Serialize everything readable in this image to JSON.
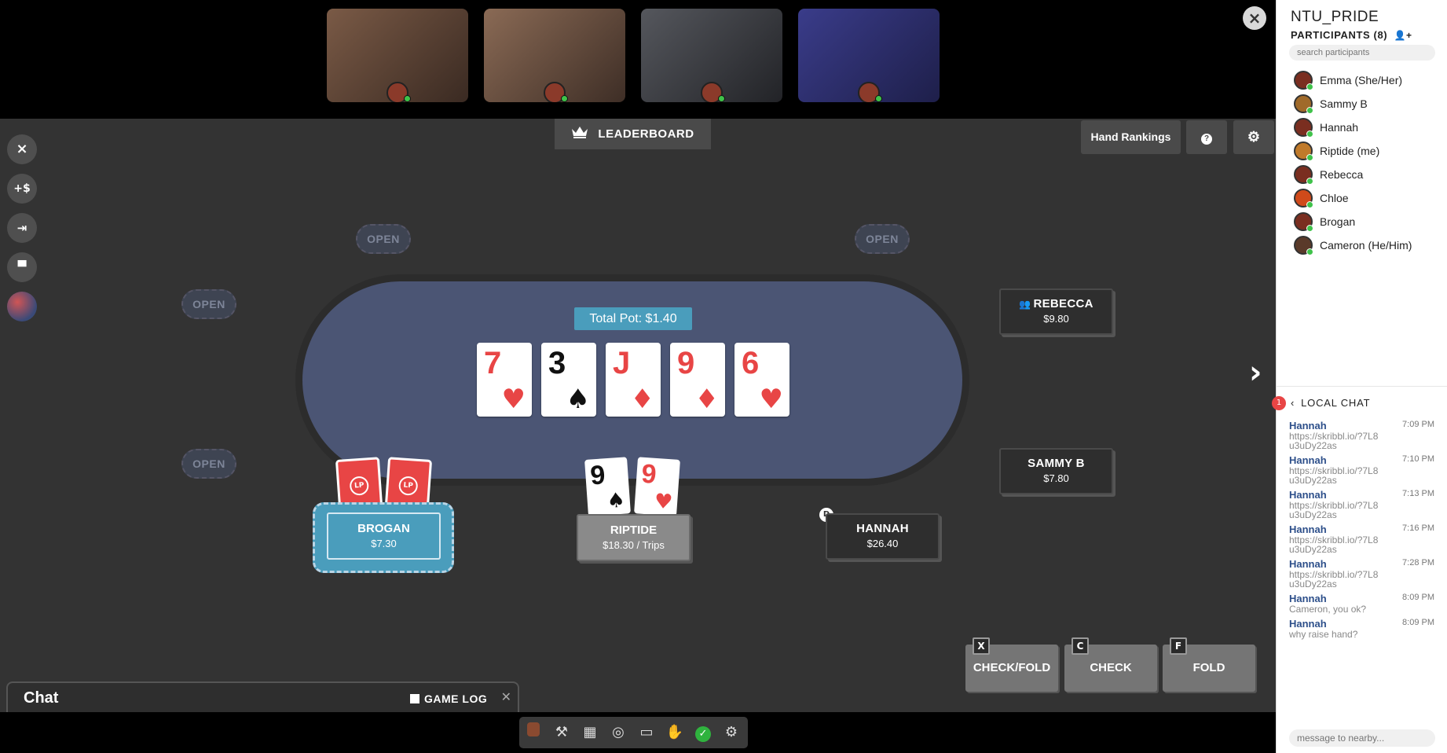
{
  "video": {
    "tiles": [
      {
        "bg": "#6b4a3a"
      },
      {
        "bg": "#5a4437"
      },
      {
        "bg": "#3d3f44"
      },
      {
        "bg": "#3b3c80"
      }
    ]
  },
  "game": {
    "leaderboard_label": "LEADERBOARD",
    "hand_rankings_label": "Hand Rankings",
    "help_icon": "?",
    "open_label": "OPEN",
    "pot_label": "Total Pot: $1.40",
    "board": [
      {
        "rank": "7",
        "suit": "♥",
        "color": "red"
      },
      {
        "rank": "3",
        "suit": "♠",
        "color": "black"
      },
      {
        "rank": "J",
        "suit": "♦",
        "color": "red"
      },
      {
        "rank": "9",
        "suit": "♦",
        "color": "red"
      },
      {
        "rank": "6",
        "suit": "♥",
        "color": "red"
      }
    ],
    "seats": {
      "rebecca": {
        "name": "REBECCA",
        "amount": "$9.80"
      },
      "sammy": {
        "name": "SAMMY B",
        "amount": "$7.80"
      },
      "hannah": {
        "name": "HANNAH",
        "amount": "$26.40"
      },
      "riptide": {
        "name": "RIPTIDE",
        "amount": "$18.30 / Trips"
      },
      "brogan": {
        "name": "BROGAN",
        "amount": "$7.30"
      }
    },
    "hole_cards": [
      {
        "rank": "9",
        "suit": "♠",
        "color": "black"
      },
      {
        "rank": "9",
        "suit": "♥",
        "color": "red"
      }
    ],
    "card_back_label": "LP",
    "dealer_label": "D",
    "actions": {
      "check_fold": {
        "label": "CHECK/FOLD",
        "key": "X"
      },
      "check": {
        "label": "CHECK",
        "key": "C"
      },
      "fold": {
        "label": "FOLD",
        "key": "F"
      }
    },
    "chat_label": "Chat",
    "game_log_label": "GAME LOG"
  },
  "sidebar": {
    "room_name": "NTU_PRIDE",
    "participants_header": "PARTICIPANTS (8)",
    "search_placeholder": "search participants",
    "participants": [
      {
        "name": "Emma (She/Her)"
      },
      {
        "name": "Sammy B"
      },
      {
        "name": "Hannah"
      },
      {
        "name": "Riptide (me)"
      },
      {
        "name": "Rebecca"
      },
      {
        "name": "Chloe"
      },
      {
        "name": "Brogan"
      },
      {
        "name": "Cameron (He/Him)"
      }
    ],
    "local_chat": {
      "title": "LOCAL CHAT",
      "badge": "1",
      "messages": [
        {
          "who": "Hannah",
          "time": "7:09 PM",
          "text": "https://skribbl.io/?7L8u3uDy22as"
        },
        {
          "who": "Hannah",
          "time": "7:10 PM",
          "text": "https://skribbl.io/?7L8u3uDy22as"
        },
        {
          "who": "Hannah",
          "time": "7:13 PM",
          "text": "https://skribbl.io/?7L8u3uDy22as"
        },
        {
          "who": "Hannah",
          "time": "7:16 PM",
          "text": "https://skribbl.io/?7L8u3uDy22as"
        },
        {
          "who": "Hannah",
          "time": "7:28 PM",
          "text": "https://skribbl.io/?7L8u3uDy22as"
        },
        {
          "who": "Hannah",
          "time": "8:09 PM",
          "text": "Cameron, you ok?"
        },
        {
          "who": "Hannah",
          "time": "8:09 PM",
          "text": "why raise hand?"
        }
      ],
      "input_placeholder": "message to nearby..."
    }
  }
}
